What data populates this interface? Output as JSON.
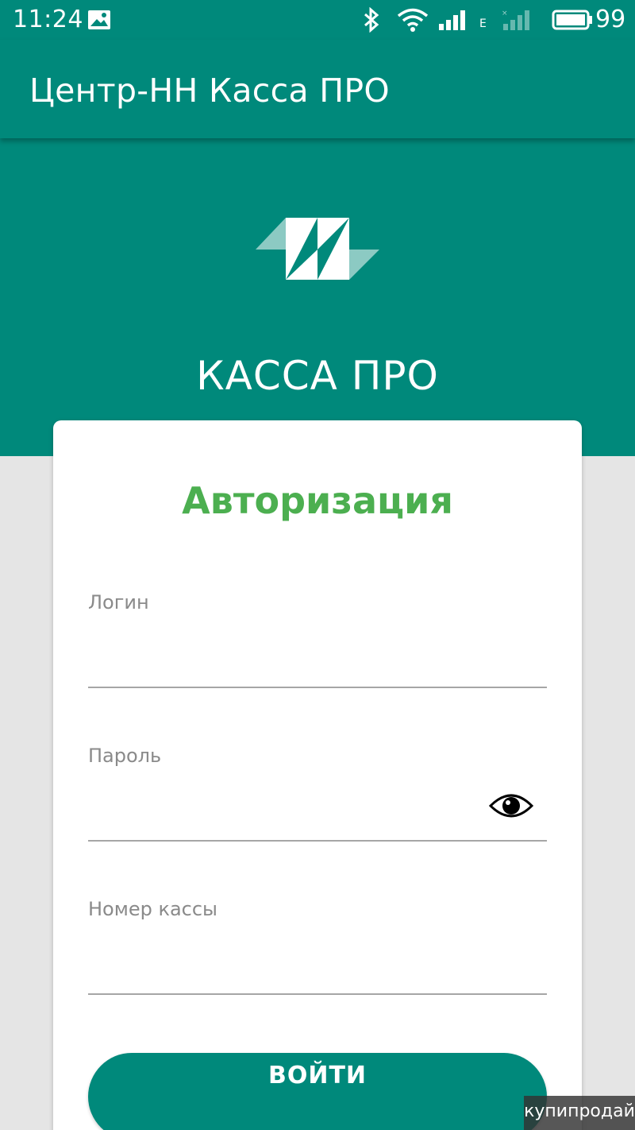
{
  "status_bar": {
    "time": "11:24",
    "network_type": "E",
    "battery": "99",
    "icons": [
      "image-notification-icon",
      "bluetooth-icon",
      "wifi-icon",
      "signal-icon",
      "signal-weak-icon",
      "battery-icon"
    ]
  },
  "app_bar": {
    "title": "Центр-НН Касса ПРО"
  },
  "hero": {
    "brand": "КАССА ПРО",
    "logo": "kassa-pro-logo"
  },
  "form": {
    "title": "Авторизация",
    "login_label": "Логин",
    "password_label": "Пароль",
    "register_label": "Номер кассы",
    "login_value": "",
    "password_value": "",
    "register_value": "",
    "submit_label": "ВОЙТИ"
  },
  "watermark": {
    "text": "купипродай"
  },
  "colors": {
    "primary": "#00897b",
    "accent_green": "#4caf50",
    "background": "#e5e5e5",
    "card": "#ffffff"
  }
}
